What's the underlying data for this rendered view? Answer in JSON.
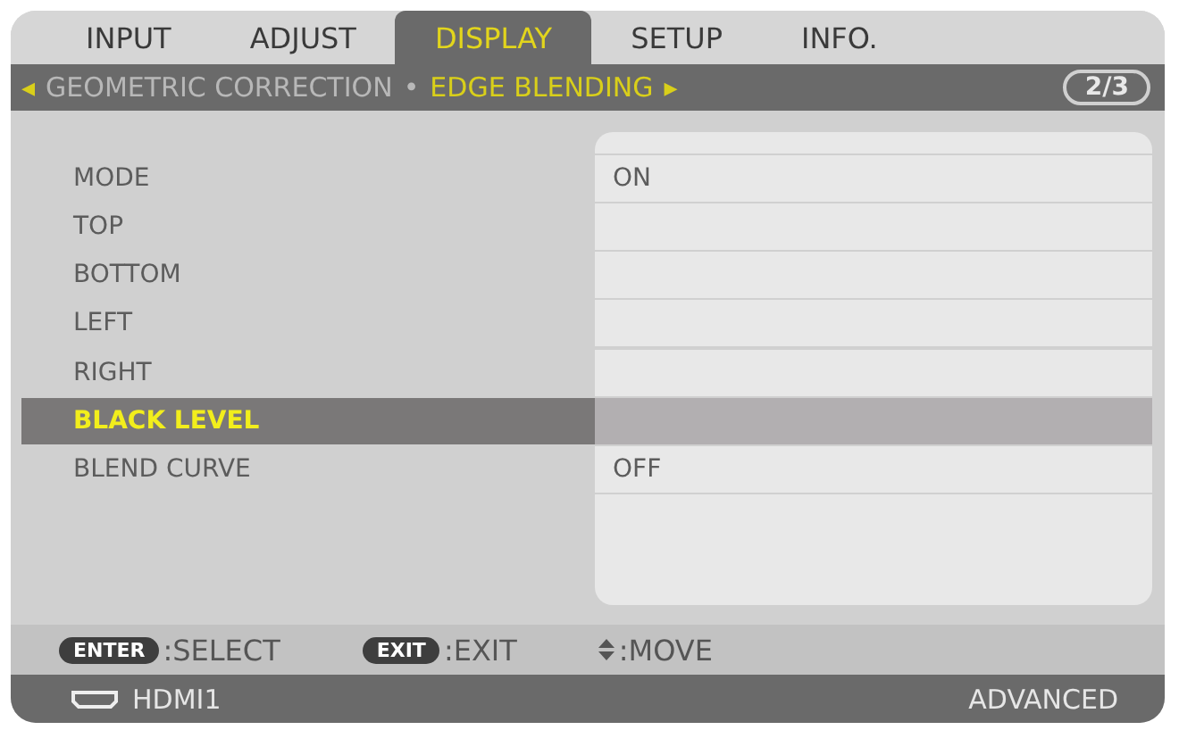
{
  "tabs": [
    {
      "label": "INPUT",
      "selected": false
    },
    {
      "label": "ADJUST",
      "selected": false
    },
    {
      "label": "DISPLAY",
      "selected": true
    },
    {
      "label": "SETUP",
      "selected": false
    },
    {
      "label": "INFO.",
      "selected": false
    }
  ],
  "breadcrumb": {
    "prev_arrow": "◂",
    "items": [
      {
        "label": "GEOMETRIC CORRECTION",
        "selected": false
      },
      {
        "label": "EDGE BLENDING",
        "selected": true
      }
    ],
    "separator": "•",
    "next_arrow": "▸",
    "page": "2/3"
  },
  "rows": [
    {
      "label": "MODE",
      "value": "ON",
      "selected": false
    },
    {
      "label": "TOP",
      "selected": false
    },
    {
      "label": "BOTTOM",
      "selected": false
    },
    {
      "label": "LEFT",
      "selected": false
    },
    {
      "label": "RIGHT",
      "selected": false
    },
    {
      "label": "BLACK LEVEL",
      "selected": true
    },
    {
      "label": "BLEND CURVE",
      "value": "OFF",
      "selected": false
    }
  ],
  "hints": [
    {
      "kind": "key",
      "key": "ENTER",
      "action": ":SELECT"
    },
    {
      "kind": "key",
      "key": "EXIT",
      "action": ":EXIT"
    },
    {
      "kind": "arrows",
      "action": ":MOVE"
    }
  ],
  "status_bar": {
    "source": "HDMI1",
    "mode": "ADVANCED"
  }
}
